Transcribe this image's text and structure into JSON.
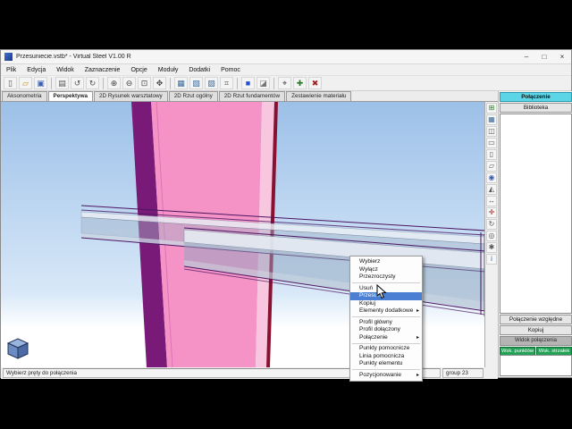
{
  "window": {
    "title": "Przesuniecie.vstb* - Virtual Steel V1.00 R",
    "minimize": "–",
    "maximize": "□",
    "close": "×"
  },
  "menubar": {
    "items": [
      "Plik",
      "Edycja",
      "Widok",
      "Zaznaczenie",
      "Opcje",
      "Moduły",
      "Dodatki",
      "Pomoc"
    ]
  },
  "toolbar": {
    "icons": [
      {
        "name": "new-file-icon",
        "glyph": "▯",
        "color": "#555555"
      },
      {
        "name": "open-file-icon",
        "glyph": "▱",
        "color": "#c09020"
      },
      {
        "name": "save-icon",
        "glyph": "▣",
        "color": "#3a5fae"
      },
      {
        "divider": true
      },
      {
        "name": "print-icon",
        "glyph": "▤",
        "color": "#555555"
      },
      {
        "name": "undo-icon",
        "glyph": "↺",
        "color": "#555555"
      },
      {
        "name": "redo-icon",
        "glyph": "↻",
        "color": "#555555"
      },
      {
        "divider": true
      },
      {
        "name": "zoom-in-icon",
        "glyph": "⊕",
        "color": "#444444"
      },
      {
        "name": "zoom-out-icon",
        "glyph": "⊖",
        "color": "#444444"
      },
      {
        "name": "zoom-window-icon",
        "glyph": "⊡",
        "color": "#444444"
      },
      {
        "name": "pan-icon",
        "glyph": "✥",
        "color": "#444444"
      },
      {
        "divider": true
      },
      {
        "name": "select-mode-icon",
        "glyph": "▦",
        "color": "#3a6c9c"
      },
      {
        "name": "wireframe-icon",
        "glyph": "▧",
        "color": "#3a6c9c"
      },
      {
        "name": "shaded-view-icon",
        "glyph": "▨",
        "color": "#3a6c9c"
      },
      {
        "name": "grid-icon",
        "glyph": "⌗",
        "color": "#555555"
      },
      {
        "divider": true
      },
      {
        "name": "color-swatch-icon",
        "glyph": "■",
        "color": "#1f4fd8"
      },
      {
        "name": "render-icon",
        "glyph": "◪",
        "color": "#777777"
      },
      {
        "divider": true
      },
      {
        "name": "measure-icon",
        "glyph": "⌖",
        "color": "#444444"
      },
      {
        "name": "add-element-icon",
        "glyph": "✚",
        "color": "#2a7a2a"
      },
      {
        "name": "delete-element-icon",
        "glyph": "✖",
        "color": "#a02020"
      }
    ]
  },
  "tabs": {
    "items": [
      "Aksonometria",
      "Perspektywa",
      "2D Rysunek warsztatowy",
      "2D Rzut ogólny",
      "2D Rzut fundamentów",
      "Zestawienie materiału"
    ],
    "selected": "Perspektywa"
  },
  "side_toolbar": {
    "icons": [
      {
        "name": "connection-tool-icon",
        "glyph": "⊞",
        "color": "#2a7a2a"
      },
      {
        "name": "grid-3d-icon",
        "glyph": "▦",
        "color": "#3a6c9c"
      },
      {
        "name": "profile-tool-icon",
        "glyph": "◫",
        "color": "#555555"
      },
      {
        "name": "beam-tool-icon",
        "glyph": "▭",
        "color": "#555555"
      },
      {
        "name": "column-tool-icon",
        "glyph": "▯",
        "color": "#555555"
      },
      {
        "name": "plate-tool-icon",
        "glyph": "▱",
        "color": "#555555"
      },
      {
        "name": "bolt-tool-icon",
        "glyph": "◉",
        "color": "#3a5fae"
      },
      {
        "name": "weld-tool-icon",
        "glyph": "◭",
        "color": "#555555"
      },
      {
        "name": "dimension-tool-icon",
        "glyph": "↔",
        "color": "#555555"
      },
      {
        "name": "axis-tool-icon",
        "glyph": "✛",
        "color": "#a02020"
      },
      {
        "name": "rotate-view-icon",
        "glyph": "↻",
        "color": "#555555"
      },
      {
        "name": "camera-icon",
        "glyph": "◎",
        "color": "#555555"
      },
      {
        "name": "settings-icon",
        "glyph": "✱",
        "color": "#555555"
      },
      {
        "name": "info-icon",
        "glyph": "i",
        "color": "#3a5fae"
      }
    ]
  },
  "right_panel": {
    "mode_buttons": [
      "Połączenie",
      "Biblioteka"
    ],
    "buttons": [
      "Połączenie względne",
      "Kopiuj"
    ],
    "section_label": "Widok połączenia",
    "green_buttons": [
      "Wsk. punktów",
      "Wsk. strzałek"
    ]
  },
  "context_menu": {
    "items": [
      "Wybierz",
      "Wyłącz",
      "Przezroczysty",
      "Usuń",
      "Przesuń",
      "Kopiuj",
      "Elementy dodatkowe",
      "Profil główny",
      "Profil dołączony",
      "Połączenie",
      "Punkty pomocnicze",
      "Linia pomocnicza",
      "Punkty elementu",
      "Pozycjonowanie"
    ],
    "highlighted": "Przesuń"
  },
  "status_bar": {
    "message": "Wybierz pręty do połączenia",
    "group": "group 23"
  },
  "colors": {
    "column_pink": "#f593c7",
    "column_edge": "#7a1a78",
    "column_highlight": "#f9c6e0",
    "column_right_edge": "#8a1030",
    "beam_line": "#4a1560",
    "selection_blue": "#4a7fd4",
    "panel_cyan": "#5cd6e6",
    "green_button": "#23a257",
    "sky_top": "#9cc0e8",
    "sky_bottom": "#ffffff"
  }
}
